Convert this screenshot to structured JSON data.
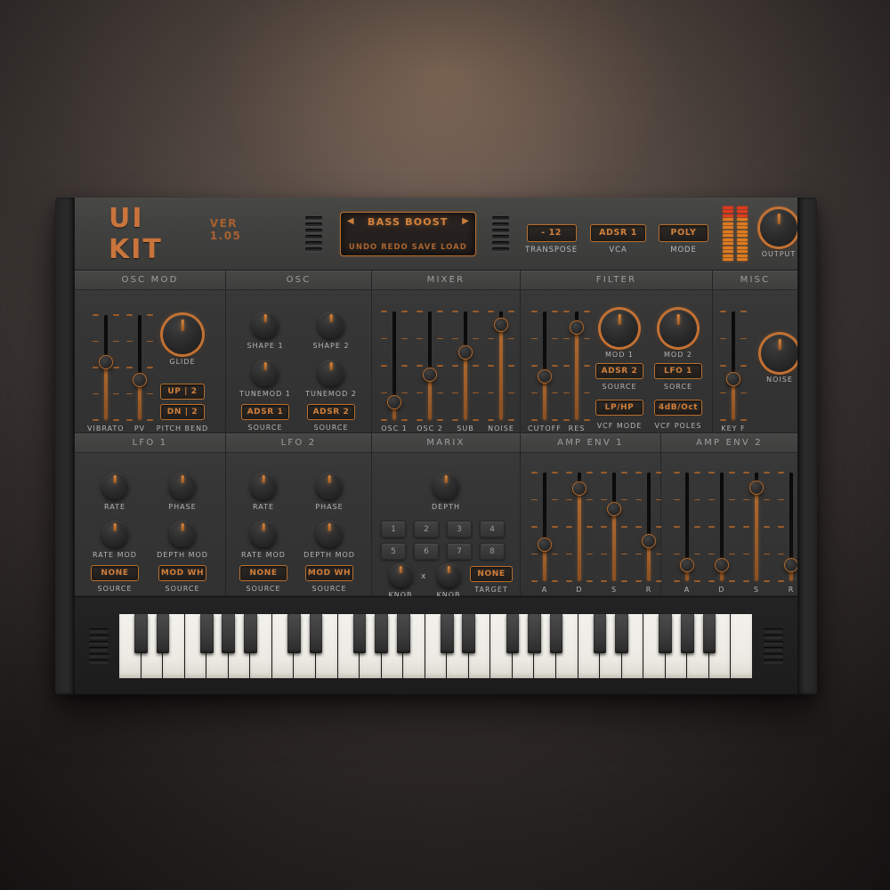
{
  "background": {
    "ambient_hex": "#6b5f59",
    "floor_hex": "#2e2a29"
  },
  "theme": {
    "accent_hex": "#c9743c",
    "accent_bright_hex": "#d07f3b",
    "panel_hex": "#363636",
    "label_hex": "#b5b5b5",
    "led_red_hex": "#e03a1c",
    "led_orange_hex": "#e07a20"
  },
  "header": {
    "brand_title": "UI KIT",
    "version": "VER 1.05",
    "preset": {
      "name": "BASS BOOST",
      "prev_arrow": "◀",
      "next_arrow": "▶",
      "actions": [
        "UNDO",
        "REDO",
        "SAVE",
        "LOAD"
      ]
    },
    "controls": [
      {
        "value": "- 12",
        "label": "TRANSPOSE"
      },
      {
        "value": "ADSR 1",
        "label": "VCA"
      },
      {
        "value": "POLY",
        "label": "MODE"
      }
    ],
    "output_knob_label": "OUTPUT",
    "led_meter": {
      "columns": 2,
      "segments": 14,
      "red_segments": 3
    }
  },
  "panels": {
    "osc_mod": {
      "title": "OSC MOD",
      "sliders": [
        {
          "label": "VIBRATO",
          "value": 55
        },
        {
          "label": "PV",
          "value": 38
        }
      ],
      "knob": {
        "label": "GLIDE"
      },
      "buttons": [
        {
          "value": "UP | 2"
        },
        {
          "value": "DN | 2"
        }
      ],
      "buttons_label": "PITCH BEND"
    },
    "osc": {
      "title": "OSC",
      "knobs": [
        {
          "label": "SHAPE 1"
        },
        {
          "label": "SHAPE 2"
        },
        {
          "label": "TUNEMOD 1"
        },
        {
          "label": "TUNEMOD 2"
        }
      ],
      "buttons": [
        {
          "value": "ADSR 1",
          "label": "SOURCE"
        },
        {
          "value": "ADSR 2",
          "label": "SOURCE"
        }
      ]
    },
    "mixer": {
      "title": "MIXER",
      "sliders": [
        {
          "label": "OSC 1",
          "value": 16
        },
        {
          "label": "OSC 2",
          "value": 42
        },
        {
          "label": "SUB",
          "value": 62
        },
        {
          "label": "NOISE",
          "value": 88
        }
      ]
    },
    "filter": {
      "title": "FILTER",
      "sliders": [
        {
          "label": "CUTOFF",
          "value": 40
        },
        {
          "label": "RES",
          "value": 85
        }
      ],
      "knobs": [
        {
          "label": "MOD 1"
        },
        {
          "label": "MOD 2"
        }
      ],
      "buttons": [
        {
          "value": "ADSR 2",
          "label": "SOURCE"
        },
        {
          "value": "LFO 1",
          "label": "SORCE"
        },
        {
          "value": "LP/HP",
          "label": "VCF MODE"
        },
        {
          "value": "4dB/Oct",
          "label": "VCF POLES"
        }
      ]
    },
    "misc": {
      "title": "MISC",
      "slider": {
        "label": "KEY F",
        "value": 38
      },
      "knob": {
        "label": "NOISE"
      }
    },
    "lfo1": {
      "title": "LFO 1",
      "knobs": [
        {
          "label": "RATE"
        },
        {
          "label": "PHASE"
        },
        {
          "label": "RATE MOD"
        },
        {
          "label": "DEPTH MOD"
        }
      ],
      "buttons": [
        {
          "value": "NONE",
          "label": "SOURCE"
        },
        {
          "value": "MOD WH",
          "label": "SOURCE"
        }
      ]
    },
    "lfo2": {
      "title": "LFO 2",
      "knobs": [
        {
          "label": "RATE"
        },
        {
          "label": "PHASE"
        },
        {
          "label": "RATE MOD"
        },
        {
          "label": "DEPTH MOD"
        }
      ],
      "buttons": [
        {
          "value": "NONE",
          "label": "SOURCE"
        },
        {
          "value": "MOD WH",
          "label": "SOURCE"
        }
      ]
    },
    "matrix": {
      "title": "MARIX",
      "depth_label": "DEPTH",
      "steps": [
        "1",
        "2",
        "3",
        "4",
        "5",
        "6",
        "7",
        "8"
      ],
      "knob_a_label": "KNOB",
      "multiply_symbol": "x",
      "knob_b_label": "KNOB",
      "target_button": "NONE",
      "target_label": "TARGET"
    },
    "amp_env_1": {
      "title": "AMP ENV 1",
      "sliders": [
        {
          "label": "A",
          "value": 34
        },
        {
          "label": "D",
          "value": 85
        },
        {
          "label": "S",
          "value": 66
        },
        {
          "label": "R",
          "value": 37
        }
      ]
    },
    "amp_env_2": {
      "title": "AMP ENV 2",
      "sliders": [
        {
          "label": "A",
          "value": 15
        },
        {
          "label": "D",
          "value": 15
        },
        {
          "label": "S",
          "value": 86
        },
        {
          "label": "R",
          "value": 15
        }
      ]
    }
  },
  "keyboard": {
    "white_key_count": 29,
    "octaves": 4
  }
}
